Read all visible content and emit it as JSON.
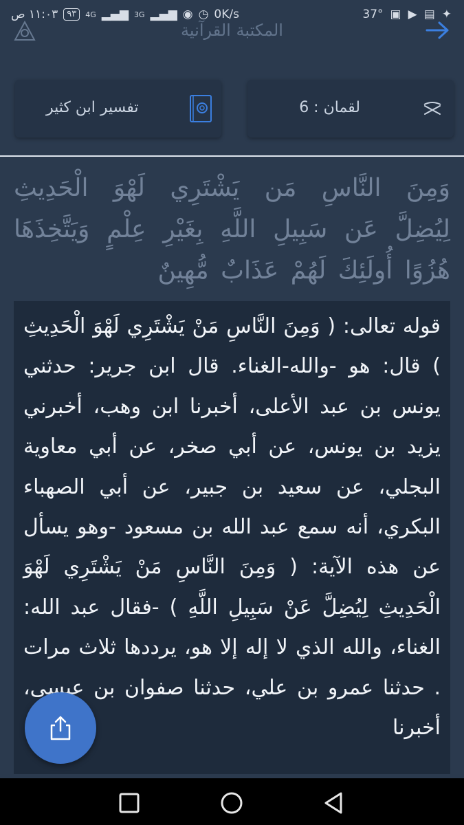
{
  "status_bar": {
    "time": "١١:٠٣ ص",
    "battery": "٩٣",
    "network_labels": [
      "4G",
      "3G"
    ],
    "speed": "0K/s",
    "temperature": "37°",
    "icons": [
      "twitter-icon",
      "gallery-icon",
      "youtube-icon",
      "calendar-icon",
      "eye-icon",
      "alarm-icon",
      "signal-icon",
      "battery-icon"
    ]
  },
  "app_bar": {
    "title": "المكتبة القرآنية"
  },
  "selectors": {
    "surah_ayah": "لقمان : 6",
    "tafsir_name": "تفسير ابن كثير"
  },
  "verse": {
    "text": "وَمِنَ النَّاسِ مَن يَشْتَرِي لَهْوَ الْحَدِيثِ لِيُضِلَّ عَن سَبِيلِ اللَّهِ بِغَيْرِ عِلْمٍ وَيَتَّخِذَهَا هُزُوًا أُولَئِكَ لَهُمْ عَذَابٌ مُّهِينٌ"
  },
  "tafsir": {
    "text": "قوله تعالى: ( وَمِنَ النَّاسِ مَنْ يَشْتَرِي لَهْوَ الْحَدِيثِ ) قال: هو -والله-الغناء. قال ابن جرير: حدثني يونس بن عبد الأعلى، أخبرنا ابن وهب، أخبرني يزيد بن يونس، عن أبي صخر، عن أبي معاوية البجلي، عن سعيد بن جبير، عن أبي الصهباء البكري، أنه سمع عبد الله بن مسعود -وهو يسأل عن هذه الآية: ( وَمِنَ النَّاسِ مَنْ يَشْتَرِي لَهْوَ الْحَدِيثِ لِيُضِلَّ عَنْ سَبِيلِ اللَّهِ ) -فقال عبد الله: الغناء، والله الذي لا إله إلا هو، يرددها ثلاث مرات . حدثنا عمرو بن علي، حدثنا صفوان بن عيسى، أخبرنا"
  },
  "colors": {
    "background": "#2b3a4e",
    "card": "#253346",
    "tafsir_panel": "#1e2b3c",
    "accent": "#3f74c9",
    "back_arrow": "#3b7fe0"
  }
}
